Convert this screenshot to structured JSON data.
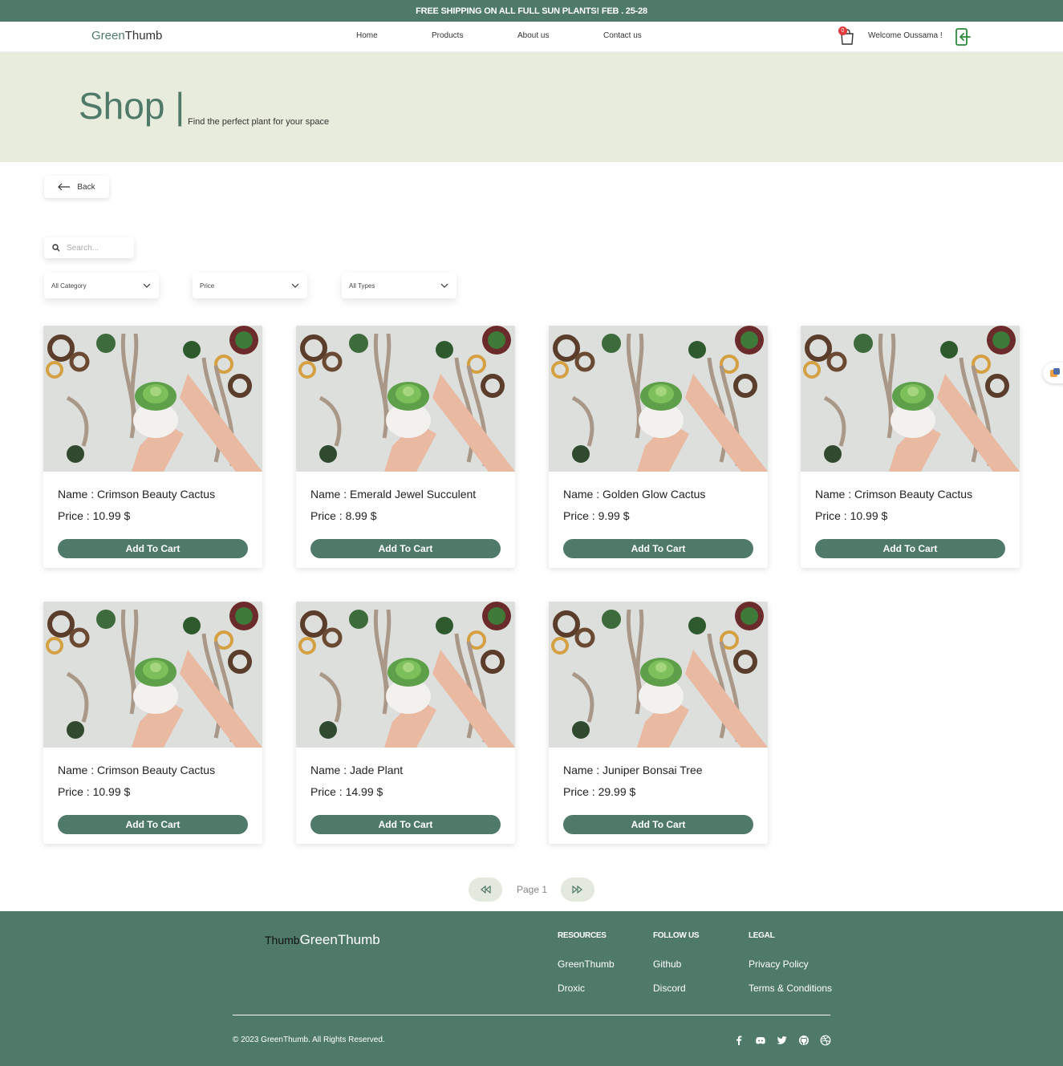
{
  "promo_banner": "FREE SHIPPING ON ALL FULL SUN PLANTS! FEB . 25-28",
  "navbar": {
    "logo_green": "Green",
    "logo_dark": "Thumb",
    "links": [
      "Home",
      "Products",
      "About us",
      "Contact us"
    ],
    "cart_count": "0",
    "welcome": "Welcome Oussama !"
  },
  "hero": {
    "title": "Shop |",
    "subtitle": "Find the perfect plant for your space"
  },
  "back_label": "Back",
  "search": {
    "placeholder": "Search..."
  },
  "filters": [
    "All Category",
    "Price",
    "All Types"
  ],
  "product_labels": {
    "name": "Name : ",
    "price": "Price : ",
    "currency": " $",
    "button": "Add To Cart"
  },
  "products": [
    {
      "name": "Crimson Beauty Cactus",
      "price": "10.99"
    },
    {
      "name": "Emerald Jewel Succulent",
      "price": "8.99"
    },
    {
      "name": "Golden Glow Cactus",
      "price": "9.99"
    },
    {
      "name": "Crimson Beauty Cactus",
      "price": "10.99"
    },
    {
      "name": "Crimson Beauty Cactus",
      "price": "10.99"
    },
    {
      "name": "Jade Plant",
      "price": "14.99"
    },
    {
      "name": "Juniper Bonsai Tree",
      "price": "29.99"
    }
  ],
  "pagination": {
    "page_label": "Page 1"
  },
  "footer": {
    "logo_dark": "Thumb",
    "logo_light": "GreenThumb",
    "resources_title": "RESOURCES",
    "resources": [
      "GreenThumb",
      "Droxic"
    ],
    "follow_title": "FOLLOW US",
    "follow": [
      "Github",
      "Discord"
    ],
    "legal_title": "LEGAL",
    "legal": [
      "Privacy Policy",
      "Terms & Conditions"
    ],
    "copyright": "© 2023 GreenThumb. All Rights Reserved.",
    "social_icons": [
      "facebook-icon",
      "discord-icon",
      "twitter-icon",
      "github-icon",
      "dribbble-icon"
    ]
  },
  "colors": {
    "brand": "#4f7a69",
    "hero_bg": "#e8ecdd",
    "pager_bg": "#e3e9dc"
  }
}
